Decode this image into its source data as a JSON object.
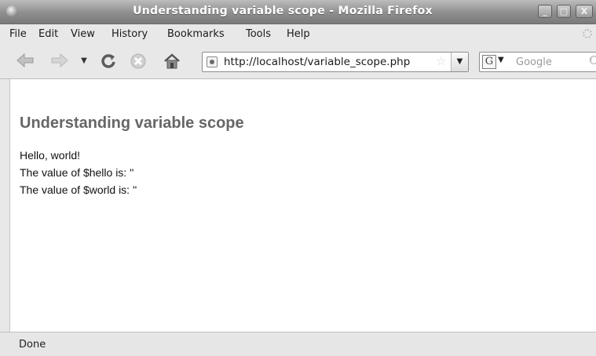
{
  "window": {
    "title": "Understanding variable scope - Mozilla Firefox",
    "controls": {
      "minimize": "_",
      "maximize": "□",
      "close": "X"
    }
  },
  "menubar": {
    "items": [
      "File",
      "Edit",
      "View",
      "History",
      "Bookmarks",
      "Tools",
      "Help"
    ]
  },
  "toolbar": {
    "back_icon": "back-arrow-icon",
    "forward_icon": "forward-arrow-icon",
    "reload_icon": "reload-icon",
    "stop_icon": "stop-icon",
    "home_icon": "home-icon",
    "url": "http://localhost/variable_scope.php",
    "search_placeholder": "Google",
    "search_engine_letter": "G"
  },
  "page": {
    "heading": "Understanding variable scope",
    "lines": [
      "Hello, world!",
      "The value of $hello is: ''",
      "The value of $world is: ''"
    ]
  },
  "statusbar": {
    "text": "Done"
  },
  "colors": {
    "heading": "#666666",
    "titlebar_text": "#ffffff",
    "content_background": "#ffffff"
  }
}
